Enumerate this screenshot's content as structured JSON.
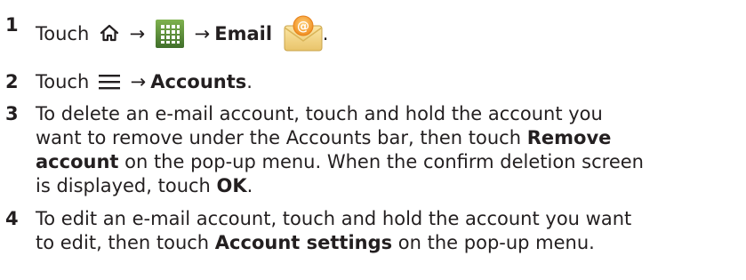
{
  "steps": [
    {
      "number": "1",
      "touch": "Touch",
      "arrow1": "→",
      "arrow2": "→",
      "email_label": "Email",
      "end": "."
    },
    {
      "number": "2",
      "touch": "Touch",
      "arrow": "→",
      "accounts_label": "Accounts",
      "end": "."
    },
    {
      "number": "3",
      "line1": "To delete an e-mail account, touch and hold the account you",
      "line2_pre": "want to remove under the Accounts bar, then touch ",
      "line2_bold": "Remove",
      "line3_bold": "account",
      "line3_post": " on the pop-up menu. When the confirm deletion screen",
      "line4_pre": "is displayed, touch ",
      "line4_bold": "OK",
      "line4_post": "."
    },
    {
      "number": "4",
      "line1": "To edit an e-mail account, touch and hold the account you want",
      "line2_pre": "to edit, then touch ",
      "line2_bold": "Account settings",
      "line2_post": " on the pop-up menu."
    }
  ],
  "icons": {
    "home": "home-icon",
    "apps": "apps-grid-icon",
    "email": "email-envelope-icon",
    "menu": "menu-hamburger-icon"
  },
  "colors": {
    "text": "#231f20",
    "apps_icon_bg": "#5a8a3c",
    "email_envelope": "#f3d889",
    "email_at": "#f5a623"
  }
}
